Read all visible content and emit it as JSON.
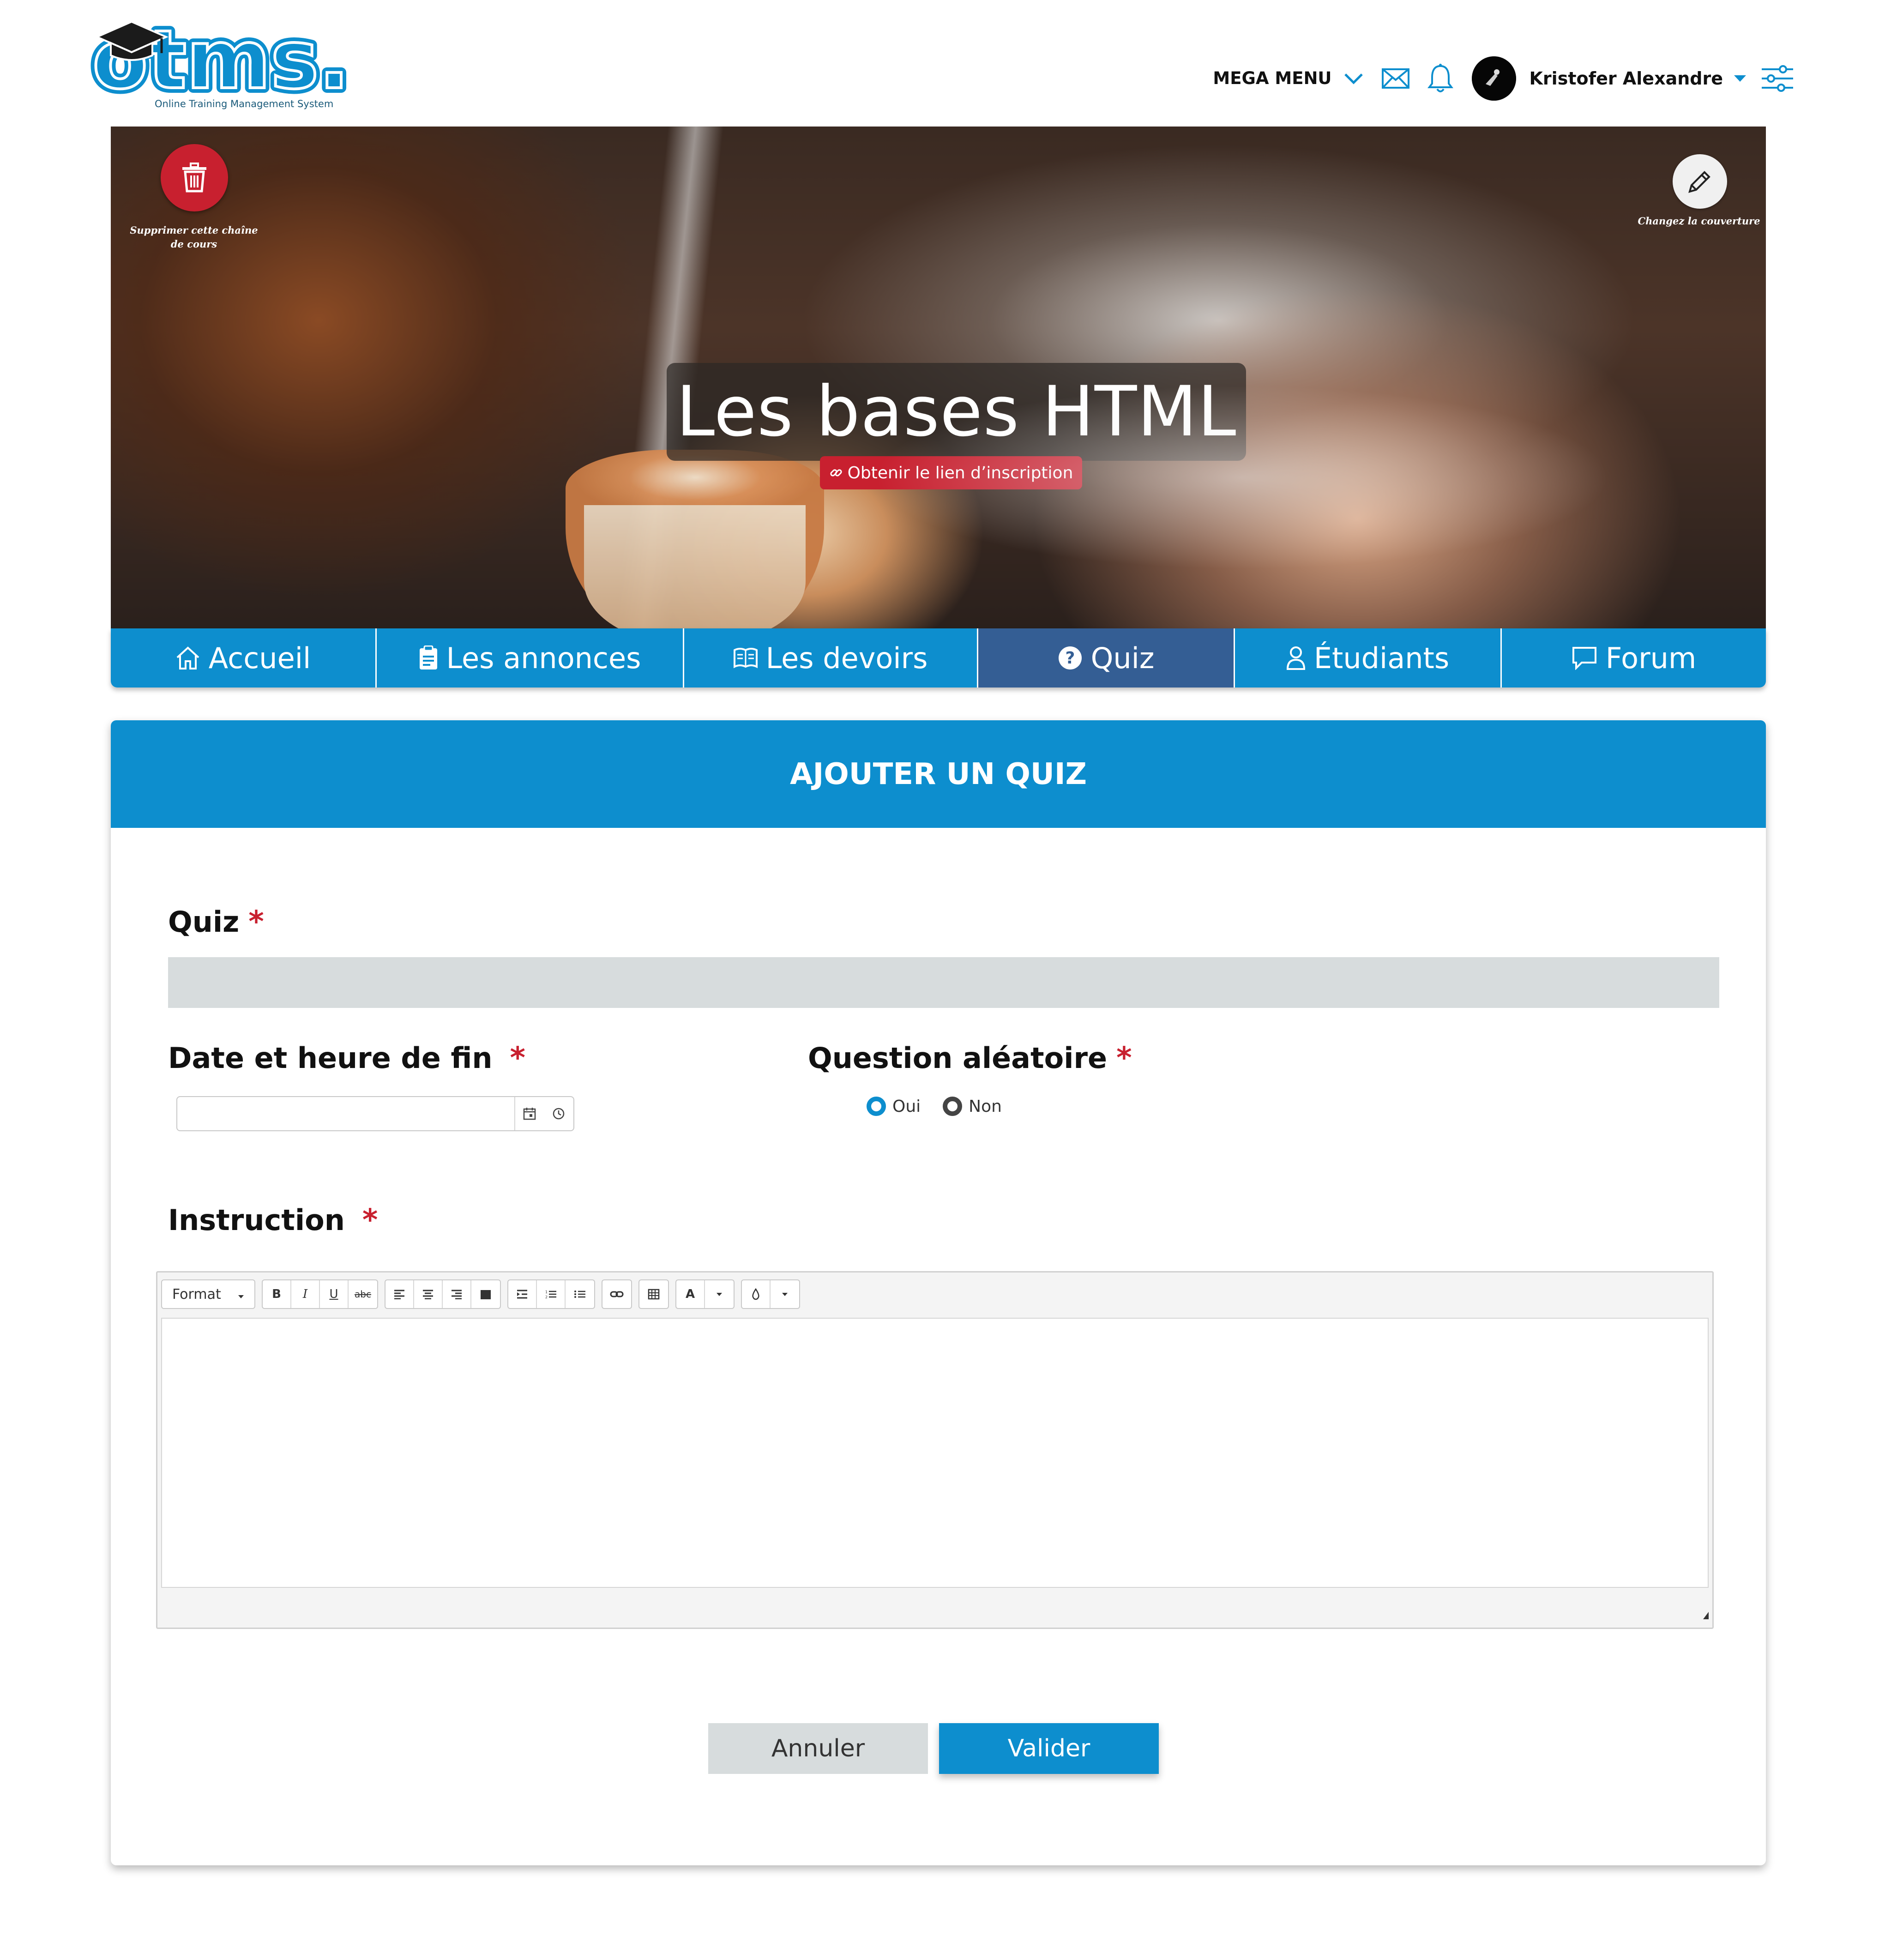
{
  "header": {
    "logo_text": "otms.",
    "logo_subtitle": "Online Training Management System",
    "mega_menu_label": "MEGA MENU",
    "user_name": "Kristofer Alexandre",
    "icons": [
      "chevron-down-icon",
      "mail-icon",
      "bell-icon",
      "avatar",
      "caret-down-icon",
      "sliders-icon"
    ]
  },
  "banner": {
    "delete_caption": "Supprimer cette chaîne de cours",
    "change_cover_caption": "Changez la couverture",
    "course_title": "Les bases HTML",
    "invite_link_label": "Obtenir le lien d’inscription"
  },
  "tabs": [
    {
      "label": "Accueil",
      "icon": "home-icon",
      "active": false
    },
    {
      "label": "Les annonces",
      "icon": "clipboard-icon",
      "active": false
    },
    {
      "label": "Les devoirs",
      "icon": "book-icon",
      "active": false
    },
    {
      "label": "Quiz",
      "icon": "question-icon",
      "active": true
    },
    {
      "label": "Étudiants",
      "icon": "user-icon",
      "active": false
    },
    {
      "label": "Forum",
      "icon": "chat-icon",
      "active": false
    }
  ],
  "form": {
    "title": "AJOUTER UN QUIZ",
    "quiz_label": "Quiz",
    "quiz_value": "",
    "end_date_label": "Date et heure de fin",
    "end_date_value": "",
    "random_question_label": "Question aléatoire",
    "random_options": [
      {
        "label": "Oui",
        "selected": true
      },
      {
        "label": "Non",
        "selected": false
      }
    ],
    "instruction_label": "Instruction",
    "required_mark": "*",
    "editor": {
      "format_label": "Format",
      "bold": "B",
      "italic": "I",
      "underline": "U",
      "strike": "abc",
      "text_color": "A"
    },
    "cancel_label": "Annuler",
    "submit_label": "Valider"
  },
  "colors": {
    "primary_blue": "#0d8ece",
    "active_tab": "#345e94",
    "danger_red": "#c8202f",
    "input_gray": "#d7dcdd"
  }
}
